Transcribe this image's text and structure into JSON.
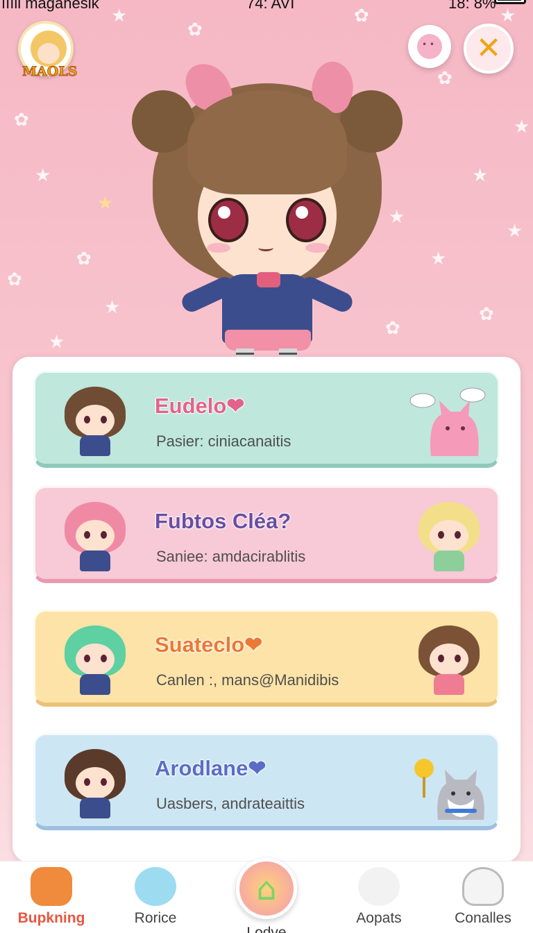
{
  "status_bar": {
    "carrier": "ıııll magahesik",
    "time": "74: AVI",
    "battery": "18: 8%"
  },
  "profile": {
    "label": "MAOLS"
  },
  "header_buttons": {
    "pet_icon": "pet-face-icon",
    "close_icon": "close-icon",
    "close_glyph": "✕"
  },
  "cards": [
    {
      "title": "Eudelo❤",
      "subtitle": "Pasier: ciniacanaitis",
      "color": "#bfe7dc"
    },
    {
      "title": "Fubtos Cléa?",
      "subtitle": "Sanieе: amdacirablitis",
      "color": "#f8c9d6"
    },
    {
      "title": "Suateclo❤",
      "subtitle": "Canlen :, mans@Manidibis",
      "color": "#fde3a7"
    },
    {
      "title": "Arodlane❤",
      "subtitle": "Uasbers, andrateaittis",
      "color": "#cde6f3"
    }
  ],
  "nav": {
    "items": [
      {
        "label": "Bupkning",
        "icon": "monster-icon",
        "active": true
      },
      {
        "label": "Rorice",
        "icon": "bubble-creature-icon",
        "active": false
      },
      {
        "label": "Lodve",
        "icon": "home-star-icon",
        "active": false
      },
      {
        "label": "Aopats",
        "icon": "pet-cat-icon",
        "active": false
      },
      {
        "label": "Conalles",
        "icon": "ghost-icon",
        "active": false
      }
    ]
  },
  "colors": {
    "accent": "#e8563f",
    "background": "#f7c6cf"
  }
}
